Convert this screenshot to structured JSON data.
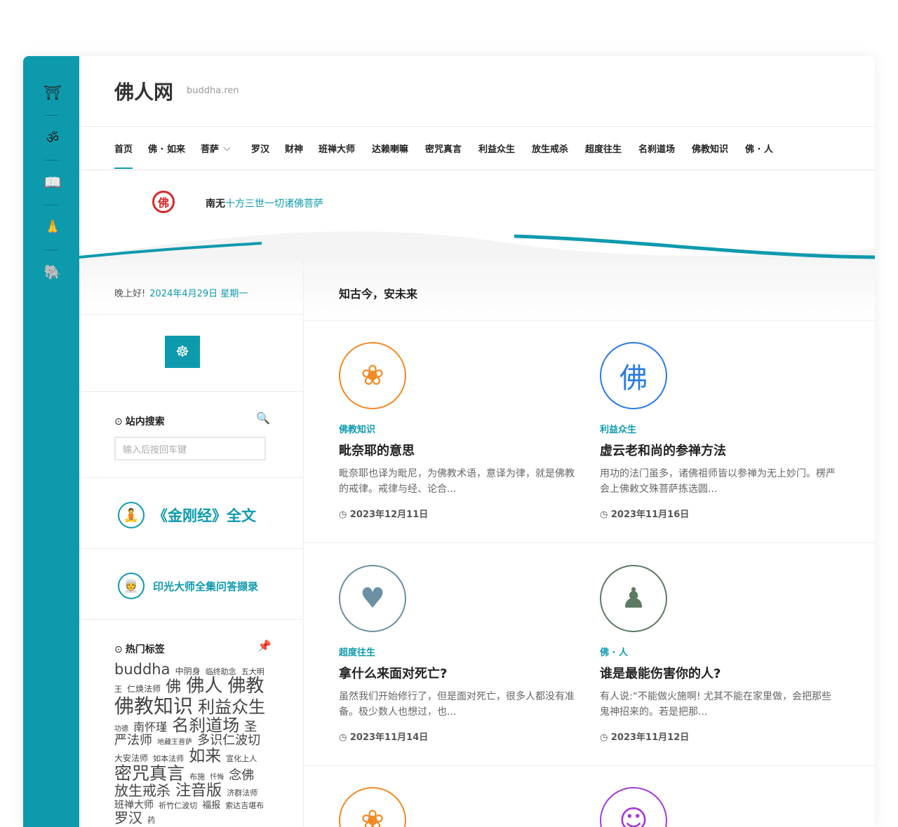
{
  "site": {
    "title": "佛人网",
    "domain": "buddha.ren"
  },
  "rail": [
    "temple-icon",
    "om-icon",
    "book-icon",
    "kneel-icon",
    "elephant-icon"
  ],
  "nav": [
    {
      "label": "首页",
      "active": true
    },
    {
      "label": "佛 · 如来"
    },
    {
      "label": "菩萨",
      "dropdown": true
    },
    {
      "label": "罗汉"
    },
    {
      "label": "财神"
    },
    {
      "label": "班禅大师"
    },
    {
      "label": "达赖喇嘛"
    },
    {
      "label": "密咒真言"
    },
    {
      "label": "利益众生"
    },
    {
      "label": "放生戒杀"
    },
    {
      "label": "超度往生"
    },
    {
      "label": "名刹道场"
    },
    {
      "label": "佛教知识"
    },
    {
      "label": "佛 · 人"
    }
  ],
  "notice": {
    "prefix": "南无",
    "link": "十方三世一切诸佛菩萨",
    "logo": "佛"
  },
  "sidebar": {
    "greeting": "晚上好!",
    "date": "2024年4月29日 星期一",
    "search_title": "站内搜索",
    "search_placeholder": "输入后按回车键",
    "promo1": "《金刚经》全文",
    "promo2": "印光大师全集问答撷录",
    "tags_title": "热门标签",
    "tags": [
      {
        "t": "buddha",
        "s": 21
      },
      {
        "t": "中阴身",
        "s": 12
      },
      {
        "t": "临终助念",
        "s": 11
      },
      {
        "t": "五大明王",
        "s": 11
      },
      {
        "t": "仁焕法师",
        "s": 12
      },
      {
        "t": "佛",
        "s": 22
      },
      {
        "t": "佛人",
        "s": 26
      },
      {
        "t": "佛教",
        "s": 26
      },
      {
        "t": "佛教知识",
        "s": 28
      },
      {
        "t": "利益众生",
        "s": 24
      },
      {
        "t": "功德",
        "s": 10
      },
      {
        "t": "南怀瑾",
        "s": 16
      },
      {
        "t": "名刹道场",
        "s": 24
      },
      {
        "t": "圣严法师",
        "s": 18
      },
      {
        "t": "地藏王菩萨",
        "s": 10
      },
      {
        "t": "多识仁波切",
        "s": 18
      },
      {
        "t": "大安法师",
        "s": 12
      },
      {
        "t": "如本法师",
        "s": 11
      },
      {
        "t": "如来",
        "s": 23
      },
      {
        "t": "宣化上人",
        "s": 11
      },
      {
        "t": "密咒真言",
        "s": 25
      },
      {
        "t": "布施",
        "s": 11
      },
      {
        "t": "忏悔",
        "s": 10
      },
      {
        "t": "念佛",
        "s": 18
      },
      {
        "t": "放生戒杀",
        "s": 20
      },
      {
        "t": "注音版",
        "s": 22
      },
      {
        "t": "济群法师",
        "s": 11
      },
      {
        "t": "班禅大师",
        "s": 14
      },
      {
        "t": "祈竹仁波切",
        "s": 11
      },
      {
        "t": "福报",
        "s": 13
      },
      {
        "t": "索达吉堪布",
        "s": 11
      },
      {
        "t": "罗汉",
        "s": 20
      },
      {
        "t": "药",
        "s": 11
      }
    ]
  },
  "main": {
    "section_title": "知古今，安未来",
    "cards": [
      {
        "cat": "佛教知识",
        "title": "毗奈耶的意思",
        "excerpt": "毗奈耶也译为毗尼，为佛教术语，意译为律，就是佛教的戒律。戒律与经、论合...",
        "date": "2023年12月11日",
        "icon": "lotus-icon",
        "color": "#f08a24"
      },
      {
        "cat": "利益众生",
        "title": "虚云老和尚的参禅方法",
        "excerpt": "用功的法门虽多，诸佛祖师皆以参禅为无上妙门。楞严会上佛敕文殊菩萨拣选圆...",
        "date": "2023年11月16日",
        "icon": "book-fo-icon",
        "color": "#2a7be0"
      },
      {
        "cat": "超度往生",
        "title": "拿什么来面对死亡?",
        "excerpt": "虽然我们开始修行了，但是面对死亡，很多人都没有准备。极少数人也想过，也...",
        "date": "2023年11月14日",
        "icon": "heart-hand-icon",
        "color": "#6c8fa3"
      },
      {
        "cat": "佛 · 人",
        "title": "谁是最能伤害你的人?",
        "excerpt": "有人说:“不能做火施啊! 尤其不能在家里做，会把那些鬼神招来的。若是把那...",
        "date": "2023年11月12日",
        "icon": "person-icon",
        "color": "#5d7a62"
      }
    ]
  }
}
